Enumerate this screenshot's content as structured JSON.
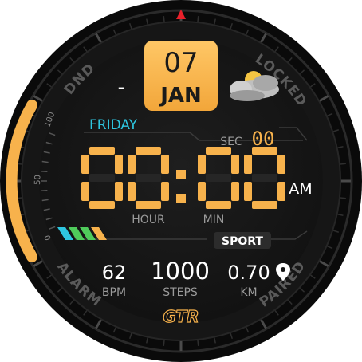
{
  "bezel": {
    "top_left_label": "DND",
    "top_right_label": "LOCKED",
    "bottom_left_label": "ALARM",
    "bottom_right_label": "PAIRED"
  },
  "date": {
    "day_number": "07",
    "month": "JAN",
    "weekday": "FRIDAY"
  },
  "weather": {
    "temperature": "-",
    "icon": "partly-cloudy-icon"
  },
  "time": {
    "hours": "00",
    "minutes": "00",
    "separator": ":",
    "ampm": "AM",
    "hour_label": "HOUR",
    "minute_label": "MIN",
    "seconds_label": "SEC",
    "seconds": "00"
  },
  "mode": {
    "label": "SPORT"
  },
  "battery_scale": {
    "top": "100",
    "middle": "50",
    "bottom": "0",
    "level_percent": 100
  },
  "stats": {
    "heart_rate": {
      "value": "62",
      "unit": "BPM"
    },
    "steps": {
      "value": "1000",
      "unit": "STEPS"
    },
    "distance": {
      "value": "0.70",
      "unit": "KM",
      "icon": "location-pin-icon"
    }
  },
  "brand": {
    "logo": "GTR"
  },
  "colors": {
    "accent_orange": "#F7B24C",
    "accent_cyan": "#2EC6E0",
    "accent_green": "#4FCB5B",
    "marker_red": "#E8202A",
    "face_dark": "#151515",
    "bezel": "#0D0D0D"
  }
}
